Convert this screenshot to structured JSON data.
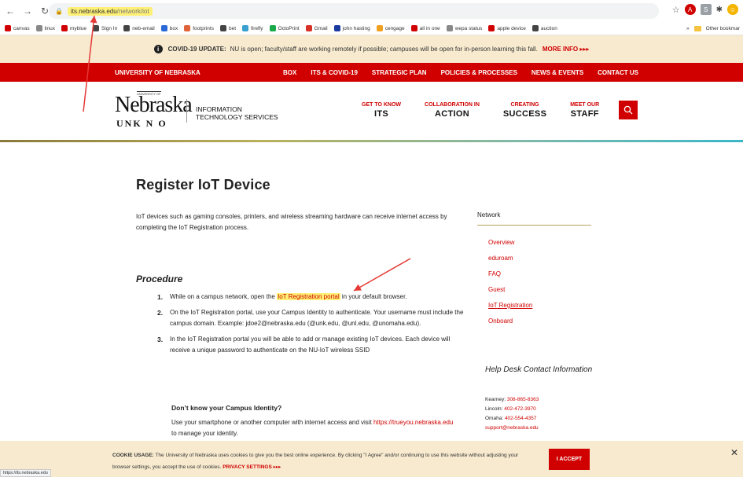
{
  "browser": {
    "url_host": "its.nebraska.edu",
    "url_path": "/network/iot",
    "status_url": "https://its.nebraska.edu"
  },
  "bookmarks": [
    {
      "label": "canvas",
      "color": "#d00000"
    },
    {
      "label": "linux",
      "color": "#888888"
    },
    {
      "label": "myblue",
      "color": "#d00000"
    },
    {
      "label": "Sign In",
      "color": "#444444"
    },
    {
      "label": "neb-email",
      "color": "#444444"
    },
    {
      "label": "box",
      "color": "#2a6ad6"
    },
    {
      "label": "footprints",
      "color": "#e0633a"
    },
    {
      "label": "bet",
      "color": "#444444"
    },
    {
      "label": "firefly",
      "color": "#3aa0d0"
    },
    {
      "label": "OctoPrint",
      "color": "#1aaa4a"
    },
    {
      "label": "Gmail",
      "color": "#d93025"
    },
    {
      "label": "john hasting",
      "color": "#1a3aa0"
    },
    {
      "label": "cengage",
      "color": "#f0a020"
    },
    {
      "label": "all in one",
      "color": "#d00000"
    },
    {
      "label": "wepa status",
      "color": "#888888"
    },
    {
      "label": "apple device",
      "color": "#d00000"
    },
    {
      "label": "auction",
      "color": "#444444"
    }
  ],
  "bookmarks_more": "»",
  "bookmarks_other": "Other bookmar",
  "covid": {
    "bold": "COVID-19 UPDATE:",
    "text": "NU is open; faculty/staff are working remotely if possible; campuses will be open for in-person learning this fall.",
    "more": "MORE INFO ▸▸▸"
  },
  "redbar": {
    "university": "UNIVERSITY OF NEBRASKA",
    "links": [
      "BOX",
      "ITS & COVID-19",
      "STRATEGIC PLAN",
      "POLICIES & PROCESSES",
      "NEWS & EVENTS",
      "CONTACT US"
    ]
  },
  "header": {
    "logo_main": "Nebraska",
    "logo_top": "UNIVERSITY OF",
    "logo_campuses": "UNK N O",
    "its_line1": "INFORMATION",
    "its_line2": "TECHNOLOGY SERVICES",
    "nav": [
      {
        "small": "GET TO KNOW",
        "big": "ITS"
      },
      {
        "small": "COLLABORATION IN",
        "big": "ACTION"
      },
      {
        "small": "CREATING",
        "big": "SUCCESS"
      },
      {
        "small": "MEET OUR",
        "big": "STAFF"
      }
    ]
  },
  "main": {
    "title": "Register IoT Device",
    "intro": "IoT devices such as gaming consoles, printers, and wireless streaming hardware can receive internet access by completing the IoT Registration process.",
    "procedure_heading": "Procedure",
    "step1_pre": "While on a campus network, open the ",
    "step1_link": "IoT Registration portal",
    "step1_post": " in your default browser.",
    "step2": "On the IoT Registration portal, use your Campus Identity to authenticate. Your username must include the campus domain. Example: jdoe2@nebraska.edu (@unk.edu, @unl.edu, @unomaha.edu).",
    "step3": "In the IoT Registration portal you will be able to add or manage existing IoT devices. Each device will receive a unique password to authenticate on the NU-IoT wireless SSID",
    "dont_know_heading": "Don’t know your Campus Identity?",
    "dont_know_pre": "Use your smartphone or another computer with internet access and visit ",
    "dont_know_link": "https://trueyou.nebraska.edu",
    "dont_know_post": " to manage your identity."
  },
  "sidebar": {
    "heading": "Network",
    "items": [
      "Overview",
      "eduroam",
      "FAQ",
      "Guest",
      "IoT Registration",
      "Onboard"
    ],
    "help_heading": "Help Desk Contact Information",
    "contacts": [
      {
        "label": "Kearney: ",
        "phone": "308-865-8363"
      },
      {
        "label": "Lincoln: ",
        "phone": "402-472-3970"
      },
      {
        "label": "Omaha: ",
        "phone": "402-554-4357"
      }
    ],
    "support_email": "support@nebraska.edu"
  },
  "cookie": {
    "bold": "COOKIE USAGE:",
    "text": "The University of Nebraska uses cookies to give you the best online experience. By clicking \"I Agree\" and/or continuing to use this website without adjusting your browser settings, you accept the use of cookies.",
    "privacy": "PRIVACY SETTINGS ▸▸▸",
    "accept": "I ACCEPT",
    "close": "✕"
  },
  "colors": {
    "brand_red": "#d00000",
    "banner_bg": "#f7eacf",
    "highlight": "#fff176",
    "annotation_arrow": "#e53935"
  }
}
